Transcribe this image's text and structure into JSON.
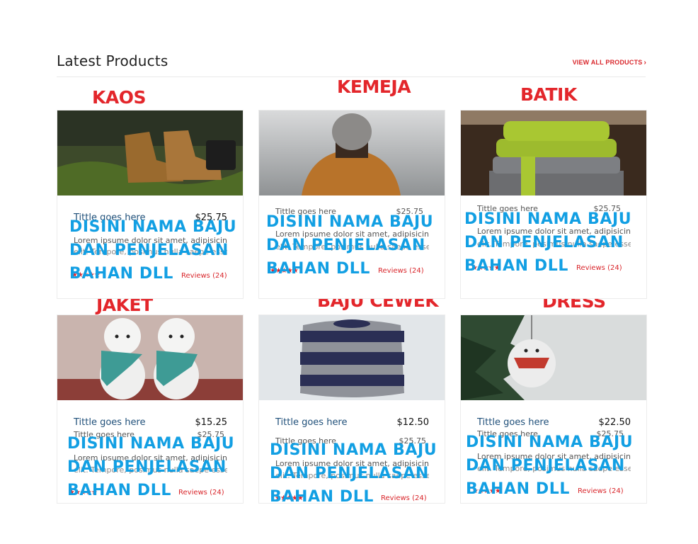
{
  "header": {
    "title": "Latest Products",
    "view_all": "VIEW ALL PRODUCTS",
    "chevron": "›"
  },
  "categories": [
    "KAOS",
    "KEMEJA",
    "BATIK",
    "JAKET",
    "BAJU CEWEK",
    "DRESS"
  ],
  "overlay": {
    "line1": "DISINI NAMA BAJU",
    "line2": "DAN PENJELASAN",
    "line3": "BAHAN DLL"
  },
  "products": [
    {
      "title": "Tittle goes here",
      "price": "$25.75",
      "ghost_title": "",
      "ghost_price": "",
      "desc": "Lorem ipsume dolor sit amet, adipisicing",
      "desc2": "elit. Tempore, posimus nulla saepe esse",
      "reviews": "Reviews (24)",
      "image": "boots"
    },
    {
      "title": "",
      "price": "",
      "ghost_title": "Tittle goes here",
      "ghost_price": "$25.75",
      "desc": "Lorem ipsume dolor sit amet, adipisicing",
      "desc2": "elit. Tempore, posimus nulla saepe esse",
      "reviews": "Reviews (24)",
      "image": "beanie"
    },
    {
      "title": "",
      "price": "",
      "ghost_title": "Tittle goes here",
      "ghost_price": "$25.75",
      "desc": "Lorem ipsume dolor sit amet, adipisicing",
      "desc2": "elit. Tempore, posimus nulla saepe esse",
      "reviews": "Reviews (24)",
      "image": "scarves"
    },
    {
      "title": "Tittle goes here",
      "price": "$15.25",
      "ghost_title": "Tittle goes here",
      "ghost_price": "$25.75",
      "desc": "Lorem ipsume dolor sit amet, adipisicing",
      "desc2": "elit. Tempore, posimus nulla saepe esse",
      "reviews": "Reviews (24)",
      "image": "snowmen"
    },
    {
      "title": "Tittle goes here",
      "price": "$12.50",
      "ghost_title": "Tittle goes here",
      "ghost_price": "$25.75",
      "desc": "Lorem ipsume dolor sit amet, adipisicing",
      "desc2": "elit. Tempore, posimus nulla saepe esse",
      "reviews": "Reviews (24)",
      "image": "sweater"
    },
    {
      "title": "Tittle goes here",
      "price": "$22.50",
      "ghost_title": "Tittle goes here",
      "ghost_price": "$25.75",
      "desc": "Lorem ipsume dolor sit amet, adipisicing",
      "desc2": "elit. Tempore, posimus nulla saepe esse",
      "reviews": "Reviews (24)",
      "image": "ornament"
    }
  ],
  "stars_glyph": "★★★★★",
  "colors": {
    "accent_red": "#e3262b",
    "overlay_blue": "#129fe3",
    "title_blue": "#20507a"
  }
}
